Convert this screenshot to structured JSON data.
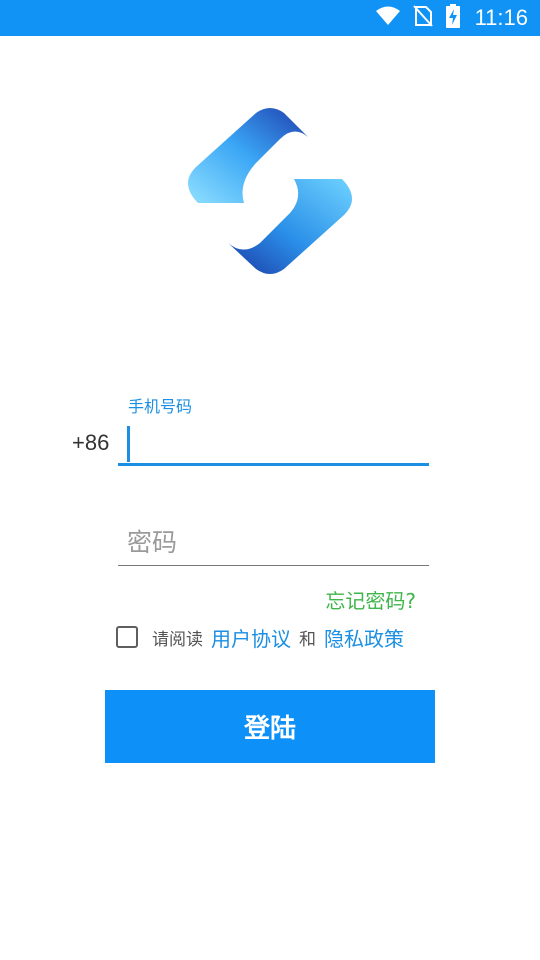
{
  "status_bar": {
    "time": "11:16",
    "icons": [
      "wifi-icon",
      "no-sim-icon",
      "battery-charging-icon"
    ]
  },
  "login": {
    "phone_label": "手机号码",
    "country_code": "+86",
    "phone_value": "",
    "password_placeholder": "密码",
    "forgot_password": "忘记密码?",
    "agree_prefix": "请阅读",
    "user_agreement": "用户协议",
    "agree_and": "和",
    "privacy_policy": "隐私政策",
    "agreement_checked": false,
    "login_button": "登陆"
  },
  "colors": {
    "status_bar": "#1193f5",
    "accent": "#1a8fe3",
    "forgot_link": "#3fb54a",
    "button": "#0d90f7"
  }
}
